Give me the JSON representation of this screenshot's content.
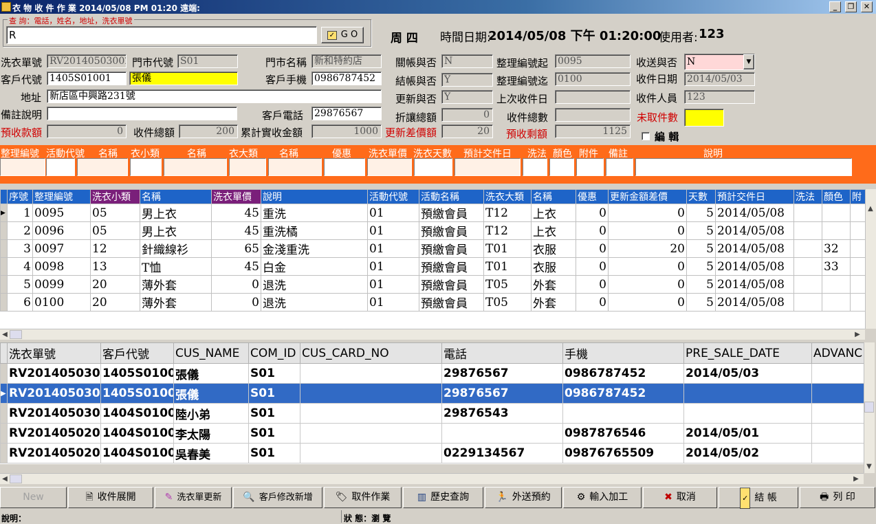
{
  "window": {
    "title": "衣 物 收 件 作 業   2014/05/08 PM 01:20 遠端:",
    "min": "_",
    "max": "❐",
    "close": "✕"
  },
  "query": {
    "legend": "查 詢：電話，姓名，地址，洗衣單號",
    "value": "R",
    "go_label": "G O"
  },
  "header": {
    "weekday": "周 四",
    "datetime_label": "時間日期:",
    "datetime": "2014/05/08 下午 01:20:00",
    "user_label": "使用者:",
    "user": "123"
  },
  "form": {
    "order_no_label": "洗衣單號",
    "order_no": "RV20140503002",
    "store_code_label": "門市代號",
    "store_code": "S01",
    "store_name_label": "門市名稱",
    "store_name": "新和特約店",
    "closed_label": "關帳與否",
    "closed": "N",
    "seq_start_label": "整理編號起",
    "seq_start": "0095",
    "deliver_label": "收送與否",
    "deliver": "N",
    "cust_code_label": "客戶代號",
    "cust_code": "1405S01001",
    "cust_name": "張儀",
    "cust_mobile_label": "客戶手機",
    "cust_mobile": "0986787452",
    "settled_label": "結帳與否",
    "settled": "Y",
    "seq_end_label": "整理編號迄",
    "seq_end": "0100",
    "recv_date_label": "收件日期",
    "recv_date": "2014/05/03",
    "address_label": "地址",
    "address": "新店區中興路231號",
    "updated_label": "更新與否",
    "updated": "Y",
    "last_recv_label": "上次收件日",
    "last_recv": "",
    "recv_person_label": "收件人員",
    "recv_person": "123",
    "note_label": "備註說明",
    "note": "",
    "cust_phone_label": "客戶電話",
    "cust_phone": "29876567",
    "discount_label": "折讓總額",
    "discount": "0",
    "recv_count_label": "收件總數",
    "recv_count": "",
    "untaken_label": "未取件數",
    "untaken": "",
    "prepay_label": "預收款額",
    "prepay": "0",
    "recv_total_label": "收件總額",
    "recv_total": "200",
    "accum_label": "累計實收金額",
    "accum": "1000",
    "diff_label": "更新差價額",
    "diff": "20",
    "remain_label": "預收剩額",
    "remain": "1125",
    "edit_label": "編 輯"
  },
  "entry_headers": [
    "整理編號",
    "活動代號",
    "名稱",
    "衣小類",
    "名稱",
    "衣大類",
    "名稱",
    "優惠",
    "洗衣單價",
    "洗衣天數",
    "預計交件日",
    "洗法",
    "顏色",
    "附件",
    "備註",
    "說明"
  ],
  "grid1": {
    "columns": [
      "序號",
      "整理編號",
      "洗衣小類",
      "名稱",
      "洗衣單價",
      "說明",
      "活動代號",
      "活動名稱",
      "洗衣大類",
      "名稱",
      "優惠",
      "更新金額差價",
      "天數",
      "預計交件日",
      "洗法",
      "顏色",
      "附"
    ],
    "rows": [
      [
        "1",
        "0095",
        "05",
        "男上衣",
        "45",
        "重洗",
        "01",
        "預繳會員",
        "T12",
        "上衣",
        "0",
        "0",
        "5",
        "2014/05/08",
        "",
        "",
        ""
      ],
      [
        "2",
        "0096",
        "05",
        "男上衣",
        "45",
        "重洗橘",
        "01",
        "預繳會員",
        "T12",
        "上衣",
        "0",
        "0",
        "5",
        "2014/05/08",
        "",
        "",
        ""
      ],
      [
        "3",
        "0097",
        "12",
        "針織線衫",
        "65",
        "金淺重洗",
        "01",
        "預繳會員",
        "T01",
        "衣服",
        "0",
        "20",
        "5",
        "2014/05/08",
        "",
        "32",
        ""
      ],
      [
        "4",
        "0098",
        "13",
        "T恤",
        "45",
        "白金",
        "01",
        "預繳會員",
        "T01",
        "衣服",
        "0",
        "0",
        "5",
        "2014/05/08",
        "",
        "33",
        ""
      ],
      [
        "5",
        "0099",
        "20",
        "薄外套",
        "0",
        "退洗",
        "01",
        "預繳會員",
        "T05",
        "外套",
        "0",
        "0",
        "5",
        "2014/05/08",
        "",
        "",
        ""
      ],
      [
        "6",
        "0100",
        "20",
        "薄外套",
        "0",
        "退洗",
        "01",
        "預繳會員",
        "T05",
        "外套",
        "0",
        "0",
        "5",
        "2014/05/08",
        "",
        "",
        ""
      ]
    ]
  },
  "grid2": {
    "columns": [
      "洗衣單號",
      "客戶代號",
      "CUS_NAME",
      "COM_ID",
      "CUS_CARD_NO",
      "電話",
      "手機",
      "PRE_SALE_DATE",
      "ADVANC"
    ],
    "rows": [
      [
        "RV201405030",
        "1405S0100",
        "張儀",
        "S01",
        "",
        "29876567",
        "0986787452",
        "2014/05/03",
        ""
      ],
      [
        "RV201405030",
        "1405S0100",
        "張儀",
        "S01",
        "",
        "29876567",
        "0986787452",
        "",
        ""
      ],
      [
        "RV201405030",
        "1404S0100",
        "陸小弟",
        "S01",
        "",
        "29876543",
        "",
        "",
        ""
      ],
      [
        "RV201405020",
        "1404S0100",
        "李太陽",
        "S01",
        "",
        "",
        "0987876546",
        "2014/05/01",
        ""
      ],
      [
        "RV201405020",
        "1404S0100",
        "吳春美",
        "S01",
        "",
        "0229134567",
        "09876765509",
        "2014/05/02",
        ""
      ]
    ],
    "selected_index": 1
  },
  "toolbar": {
    "new": "New",
    "expand": "收件展開",
    "update_order": "洗衣單更新",
    "customer_edit": "客戶修改新增",
    "pickup": "取件作業",
    "history": "歷史查詢",
    "delivery": "外送預約",
    "input_process": "輸入加工",
    "cancel": "取消",
    "checkout": "結 帳",
    "print": "列 印"
  },
  "status": {
    "desc_label": "說明：",
    "state": "狀 態：瀏 覽"
  },
  "colors": {
    "title_bar": "#0a246a",
    "orange_bar": "#ff6b1a",
    "grid_header": "#1e64c8",
    "selected_row": "#316ac5",
    "highlight_yellow": "#ffff00"
  }
}
